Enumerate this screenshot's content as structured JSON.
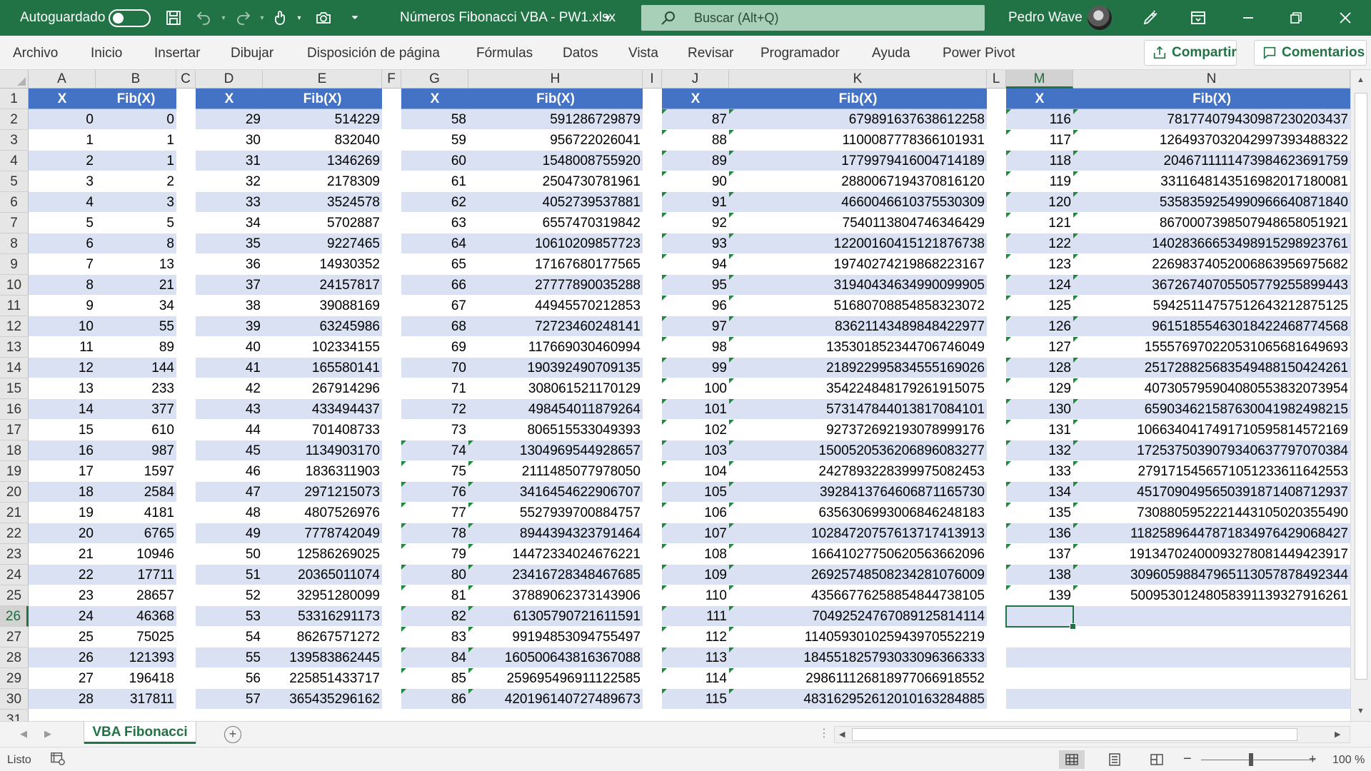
{
  "titlebar": {
    "autosave_label": "Autoguardado",
    "document_title": "Números Fibonacci VBA - PW1.xlsx",
    "search_placeholder": "Buscar (Alt+Q)",
    "user_name": "Pedro Wave",
    "colors": {
      "background": "#217346",
      "search_bg": "#a8cfb7"
    }
  },
  "ribbon": {
    "tabs": [
      "Archivo",
      "Inicio",
      "Insertar",
      "Dibujar",
      "Disposición de página",
      "Fórmulas",
      "Datos",
      "Vista",
      "Revisar",
      "Programador",
      "Ayuda",
      "Power Pivot"
    ],
    "share_label": "Compartir",
    "comments_label": "Comentarios"
  },
  "grid": {
    "columns": [
      "A",
      "B",
      "C",
      "D",
      "E",
      "F",
      "G",
      "H",
      "I",
      "J",
      "K",
      "L",
      "M",
      "N"
    ],
    "rows": [
      "1",
      "2",
      "3",
      "4",
      "5",
      "6",
      "7",
      "8",
      "9",
      "10",
      "11",
      "12",
      "13",
      "14",
      "15",
      "16",
      "17",
      "18",
      "19",
      "20",
      "21",
      "22",
      "23",
      "24",
      "25",
      "26",
      "27",
      "28",
      "29",
      "30",
      "31"
    ],
    "selected_cell": "M26",
    "header_x": "X",
    "header_fib": "Fib(X)",
    "header_color": "#4472c4",
    "band_color": "#d9e1f2",
    "blocks": [
      {
        "x": [
          "0",
          "1",
          "2",
          "3",
          "4",
          "5",
          "6",
          "7",
          "8",
          "9",
          "10",
          "11",
          "12",
          "13",
          "14",
          "15",
          "16",
          "17",
          "18",
          "19",
          "20",
          "21",
          "22",
          "23",
          "24",
          "25",
          "26",
          "27",
          "28"
        ],
        "fib": [
          "0",
          "1",
          "1",
          "2",
          "3",
          "5",
          "8",
          "13",
          "21",
          "34",
          "55",
          "89",
          "144",
          "233",
          "377",
          "610",
          "987",
          "1597",
          "2584",
          "4181",
          "6765",
          "10946",
          "17711",
          "28657",
          "46368",
          "75025",
          "121393",
          "196418",
          "317811"
        ]
      },
      {
        "x": [
          "29",
          "30",
          "31",
          "32",
          "33",
          "34",
          "35",
          "36",
          "37",
          "38",
          "39",
          "40",
          "41",
          "42",
          "43",
          "44",
          "45",
          "46",
          "47",
          "48",
          "49",
          "50",
          "51",
          "52",
          "53",
          "54",
          "55",
          "56",
          "57"
        ],
        "fib": [
          "514229",
          "832040",
          "1346269",
          "2178309",
          "3524578",
          "5702887",
          "9227465",
          "14930352",
          "24157817",
          "39088169",
          "63245986",
          "102334155",
          "165580141",
          "267914296",
          "433494437",
          "701408733",
          "1134903170",
          "1836311903",
          "2971215073",
          "4807526976",
          "7778742049",
          "12586269025",
          "20365011074",
          "32951280099",
          "53316291173",
          "86267571272",
          "139583862445",
          "225851433717",
          "365435296162"
        ]
      },
      {
        "x": [
          "58",
          "59",
          "60",
          "61",
          "62",
          "63",
          "64",
          "65",
          "66",
          "67",
          "68",
          "69",
          "70",
          "71",
          "72",
          "73",
          "74",
          "75",
          "76",
          "77",
          "78",
          "79",
          "80",
          "81",
          "82",
          "83",
          "84",
          "85",
          "86"
        ],
        "fib": [
          "591286729879",
          "956722026041",
          "1548008755920",
          "2504730781961",
          "4052739537881",
          "6557470319842",
          "10610209857723",
          "17167680177565",
          "27777890035288",
          "44945570212853",
          "72723460248141",
          "117669030460994",
          "190392490709135",
          "308061521170129",
          "498454011879264",
          "806515533049393",
          "1304969544928657",
          "2111485077978050",
          "3416454622906707",
          "5527939700884757",
          "8944394323791464",
          "14472334024676221",
          "23416728348467685",
          "37889062373143906",
          "61305790721611591",
          "99194853094755497",
          "160500643816367088",
          "259695496911122585",
          "420196140727489673"
        ]
      },
      {
        "x": [
          "87",
          "88",
          "89",
          "90",
          "91",
          "92",
          "93",
          "94",
          "95",
          "96",
          "97",
          "98",
          "99",
          "100",
          "101",
          "102",
          "103",
          "104",
          "105",
          "106",
          "107",
          "108",
          "109",
          "110",
          "111",
          "112",
          "113",
          "114",
          "115"
        ],
        "fib": [
          "679891637638612258",
          "1100087778366101931",
          "1779979416004714189",
          "2880067194370816120",
          "4660046610375530309",
          "7540113804746346429",
          "12200160415121876738",
          "19740274219868223167",
          "31940434634990099905",
          "51680708854858323072",
          "83621143489848422977",
          "135301852344706746049",
          "218922995834555169026",
          "354224848179261915075",
          "573147844013817084101",
          "927372692193078999176",
          "1500520536206896083277",
          "2427893228399975082453",
          "3928413764606871165730",
          "6356306993006846248183",
          "10284720757613717413913",
          "16641027750620563662096",
          "26925748508234281076009",
          "43566776258854844738105",
          "70492524767089125814114",
          "114059301025943970552219",
          "184551825793033096366333",
          "298611126818977066918552",
          "483162952612010163284885"
        ]
      },
      {
        "x": [
          "116",
          "117",
          "118",
          "119",
          "120",
          "121",
          "122",
          "123",
          "124",
          "125",
          "126",
          "127",
          "128",
          "129",
          "130",
          "131",
          "132",
          "133",
          "134",
          "135",
          "136",
          "137",
          "138",
          "139"
        ],
        "fib": [
          "781774079430987230203437",
          "1264937032042997393488322",
          "2046711111473984623691759",
          "3311648143516982017180081",
          "5358359254990966640871840",
          "8670007398507948658051921",
          "14028366653498915298923761",
          "22698374052006863956975682",
          "36726740705505779255899443",
          "59425114757512643212875125",
          "96151855463018422468774568",
          "155576970220531065681649693",
          "251728825683549488150424261",
          "407305795904080553832073954",
          "659034621587630041982498215",
          "1066340417491710595814572169",
          "1725375039079340637797070384",
          "2791715456571051233611642553",
          "4517090495650391871408712937",
          "7308805952221443105020355490",
          "11825896447871834976429068427",
          "19134702400093278081449423917",
          "30960598847965113057878492344",
          "50095301248058391139327916261"
        ]
      }
    ]
  },
  "sheets": {
    "active": "VBA Fibonacci"
  },
  "status": {
    "ready": "Listo",
    "zoom": "100 %"
  }
}
